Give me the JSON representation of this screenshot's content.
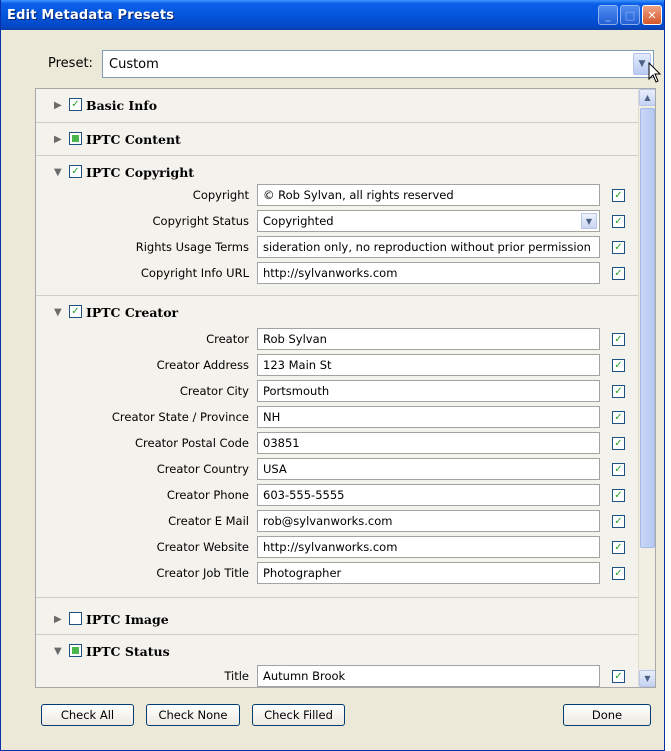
{
  "window": {
    "title": "Edit Metadata Presets"
  },
  "preset": {
    "label": "Preset:",
    "value": "Custom"
  },
  "sections": {
    "basic_info": {
      "title": "Basic Info"
    },
    "iptc_content": {
      "title": "IPTC Content"
    },
    "iptc_copyright": {
      "title": "IPTC Copyright",
      "fields": [
        {
          "label": "Copyright",
          "value": "© Rob Sylvan, all rights reserved"
        },
        {
          "label": "Copyright Status",
          "value": "Copyrighted"
        },
        {
          "label": "Rights Usage Terms",
          "value": "sideration only, no reproduction without prior permission"
        },
        {
          "label": "Copyright Info URL",
          "value": "http://sylvanworks.com"
        }
      ]
    },
    "iptc_creator": {
      "title": "IPTC Creator",
      "fields": [
        {
          "label": "Creator",
          "value": "Rob Sylvan"
        },
        {
          "label": "Creator Address",
          "value": "123 Main St"
        },
        {
          "label": "Creator City",
          "value": "Portsmouth"
        },
        {
          "label": "Creator State / Province",
          "value": "NH"
        },
        {
          "label": "Creator Postal Code",
          "value": "03851"
        },
        {
          "label": "Creator Country",
          "value": "USA"
        },
        {
          "label": "Creator Phone",
          "value": "603-555-5555"
        },
        {
          "label": "Creator E Mail",
          "value": "rob@sylvanworks.com"
        },
        {
          "label": "Creator Website",
          "value": "http://sylvanworks.com"
        },
        {
          "label": "Creator Job Title",
          "value": "Photographer"
        }
      ]
    },
    "iptc_image": {
      "title": "IPTC Image"
    },
    "iptc_status": {
      "title": "IPTC Status",
      "fields": [
        {
          "label": "Title",
          "value": "Autumn Brook"
        }
      ]
    }
  },
  "buttons": {
    "check_all": "Check All",
    "check_none": "Check None",
    "check_filled": "Check Filled",
    "done": "Done"
  },
  "glyphs": {
    "check": "✓",
    "expanded": "▼",
    "collapsed": "▶",
    "dropdown": "⌄"
  }
}
